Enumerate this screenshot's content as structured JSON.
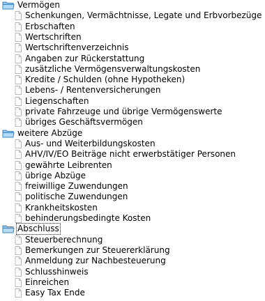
{
  "tree": {
    "categories": [
      {
        "label": "Vermögen",
        "items": [
          "Schenkungen, Vermächtnisse, Legate und Erbvorbezüge",
          "Erbschaften",
          "Wertschriften",
          "Wertschriftenverzeichnis",
          "Angaben zur Rückerstattung",
          "zusätzliche Vermögensverwaltungskosten",
          "Kredite / Schulden (ohne Hypotheken)",
          "Lebens- / Rentenversicherungen",
          "Liegenschaften",
          "private Fahrzeuge und übrige Vermögenswerte",
          "übriges Geschäftsvermögen"
        ]
      },
      {
        "label": "weitere Abzüge",
        "items": [
          "Aus- und Weiterbildungskosten",
          "AHV/IV/EO Beiträge nicht erwerbstätiger Personen",
          "gewährte Leibrenten",
          "übrige Abzüge",
          "freiwillige Zuwendungen",
          "politische Zuwendungen",
          "Krankheitskosten",
          "behinderungsbedingte Kosten"
        ]
      },
      {
        "label": "Abschluss",
        "selected": true,
        "items": [
          "Steuerberechnung",
          "Bemerkungen zur Steuererklärung",
          "Anmeldung zur Nachbesteuerung",
          "Schlusshinweis",
          "Einreichen",
          "Easy Tax Ende"
        ]
      }
    ],
    "icons": {
      "category": "folder-icon",
      "item": "document-icon"
    },
    "colors": {
      "folder_fill": "#8ec3ea",
      "folder_stroke": "#3f86c4",
      "document_stroke": "#b9b9b9"
    }
  }
}
